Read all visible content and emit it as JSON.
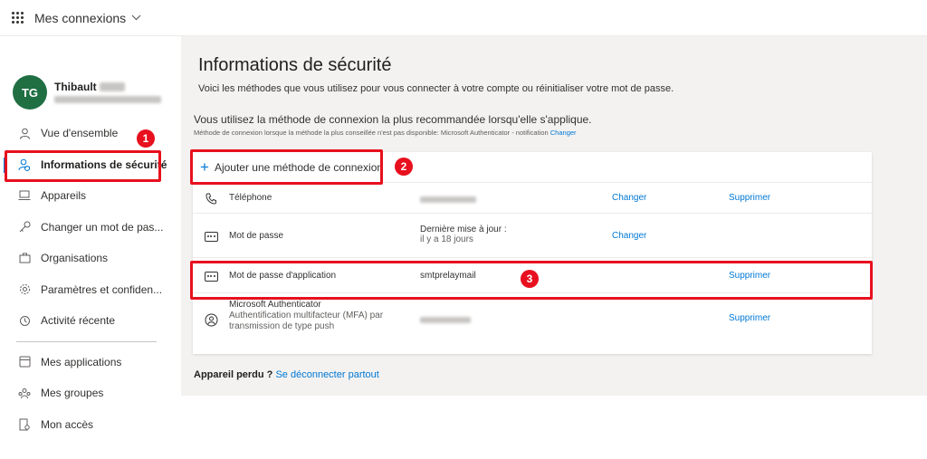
{
  "topbar": {
    "app_title": "Mes connexions"
  },
  "profile": {
    "initials": "TG",
    "first_name": "Thibault",
    "avatar_color": "#1f6f43"
  },
  "nav": {
    "items": [
      {
        "label": "Vue d'ensemble",
        "icon": "person-icon"
      },
      {
        "label": "Informations de sécurité",
        "icon": "security-person-icon",
        "active": true
      },
      {
        "label": "Appareils",
        "icon": "laptop-icon"
      },
      {
        "label": "Changer un mot de pas...",
        "icon": "key-icon"
      },
      {
        "label": "Organisations",
        "icon": "briefcase-icon"
      },
      {
        "label": "Paramètres et confiden...",
        "icon": "lock-icon"
      },
      {
        "label": "Activité récente",
        "icon": "history-icon"
      }
    ],
    "secondary": [
      {
        "label": "Mes applications",
        "icon": "apps-icon"
      },
      {
        "label": "Mes groupes",
        "icon": "groups-icon"
      },
      {
        "label": "Mon accès",
        "icon": "access-icon"
      }
    ]
  },
  "main": {
    "title": "Informations de sécurité",
    "description": "Voici les méthodes que vous utilisez pour vous connecter à votre compte ou réinitialiser votre mot de passe.",
    "default_heading": "Vous utilisez la méthode de connexion la plus recommandée lorsqu'elle s'applique.",
    "default_sub": "Méthode de connexion lorsque la méthode la plus conseillée n'est pas disponible: Microsoft Authenticator - notification",
    "default_sub_link": "Changer",
    "add_method": "Ajouter une méthode de connexion",
    "methods": [
      {
        "name": "Téléphone",
        "icon": "phone-icon",
        "detail": "",
        "change": "Changer",
        "delete": "Supprimer"
      },
      {
        "name": "Mot de passe",
        "icon": "password-icon",
        "detail_line1": "Dernière mise à jour :",
        "detail_line2": "il y a 18 jours",
        "change": "Changer",
        "delete": ""
      },
      {
        "name": "Mot de passe d'application",
        "icon": "password-icon",
        "detail": "smtprelaymail",
        "change": "",
        "delete": "Supprimer"
      },
      {
        "name": "Microsoft Authenticator",
        "sub1": "Authentification multifacteur (MFA) par",
        "sub2": "transmission de type push",
        "icon": "authenticator-icon",
        "delete": "Supprimer"
      }
    ],
    "lost_device": "Appareil perdu ?",
    "logout_all": "Se déconnecter partout"
  },
  "annotations": {
    "badge1": "1",
    "badge2": "2",
    "badge3": "3",
    "color": "#e8101e"
  },
  "colors": {
    "accent": "#0078d4",
    "main_bg": "#f3f2f1"
  }
}
